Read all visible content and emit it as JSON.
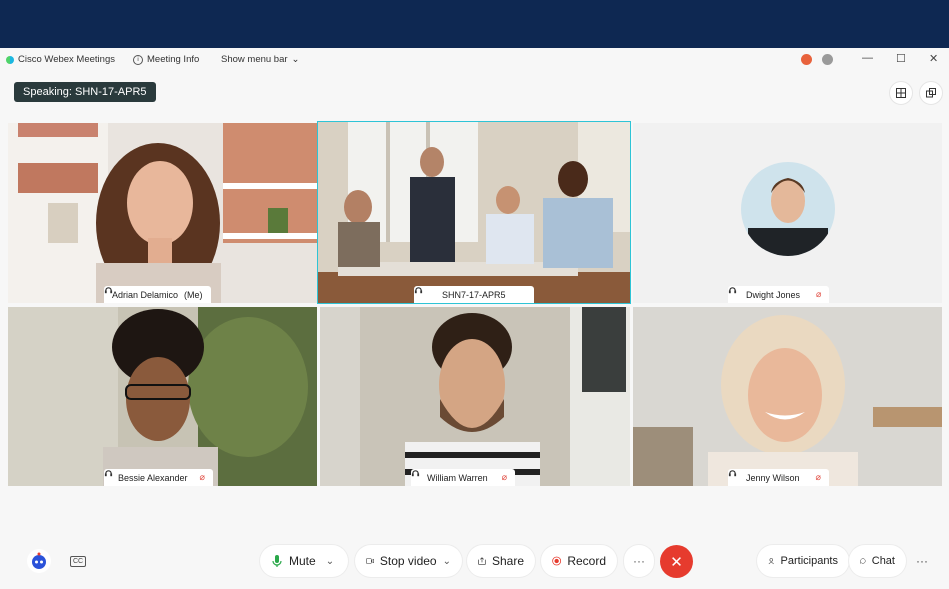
{
  "window": {
    "app_title": "Cisco Webex Meetings",
    "meeting_info_label": "Meeting Info",
    "menu_bar_label": "Show menu bar",
    "minimize": "—",
    "maximize": "☐",
    "close": "✕"
  },
  "speaking_label": "Speaking: SHN-17-APR5",
  "participants": [
    {
      "name": "Adrian Delamico",
      "suffix": "(Me)",
      "muted": false
    },
    {
      "name": "SHN7-17-APR5",
      "suffix": "",
      "muted": false
    },
    {
      "name": "Dwight Jones",
      "suffix": "",
      "muted": true
    },
    {
      "name": "Bessie Alexander",
      "suffix": "",
      "muted": true
    },
    {
      "name": "William Warren",
      "suffix": "",
      "muted": true
    },
    {
      "name": "Jenny Wilson",
      "suffix": "",
      "muted": true
    }
  ],
  "toolbar": {
    "mute_label": "Mute",
    "stop_video_label": "Stop video",
    "share_label": "Share",
    "record_label": "Record",
    "more_label": "···",
    "end_label": "✕",
    "participants_label": "Participants",
    "chat_label": "Chat",
    "overflow_label": "···",
    "cc_label": "CC"
  },
  "colors": {
    "top_band": "#0e2852",
    "active_speaker_border": "#2ec4d6",
    "end_call": "#e63b2e",
    "mute_mic": "#2aa84a",
    "record": "#e63b2e"
  }
}
